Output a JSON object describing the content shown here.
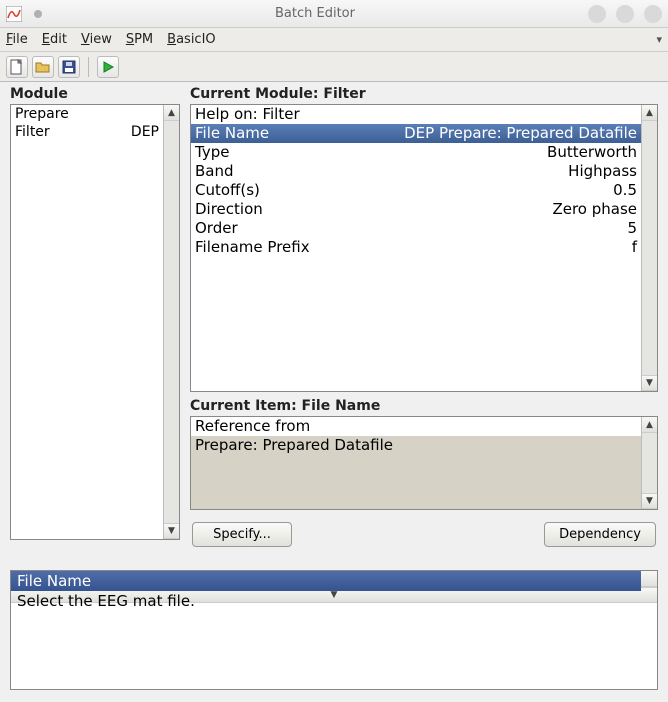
{
  "window": {
    "title": "Batch Editor"
  },
  "menubar": {
    "file": "File",
    "file_u": "F",
    "edit": "Edit",
    "edit_u": "E",
    "view": "View",
    "view_u": "V",
    "spm": "SPM",
    "spm_u": "S",
    "basicio": "BasicIO",
    "basicio_u": "B"
  },
  "toolbar": {
    "new_tip": "New",
    "open_tip": "Open",
    "save_tip": "Save",
    "run_tip": "Run"
  },
  "left": {
    "header": "Module",
    "rows": [
      {
        "label": "Prepare",
        "tag": ""
      },
      {
        "label": "Filter",
        "tag": "DEP"
      }
    ]
  },
  "current_module": {
    "header_prefix": "Current Module: ",
    "header_name": "Filter",
    "rows": [
      {
        "label": "Help on: Filter",
        "value": ""
      },
      {
        "label": "File Name",
        "value": "DEP Prepare: Prepared Datafile",
        "selected": true
      },
      {
        "label": "Type",
        "value": "Butterworth"
      },
      {
        "label": "Band",
        "value": "Highpass"
      },
      {
        "label": "Cutoff(s)",
        "value": "0.5"
      },
      {
        "label": "Direction",
        "value": "Zero phase"
      },
      {
        "label": "Order",
        "value": "5"
      },
      {
        "label": "Filename Prefix",
        "value": "f"
      }
    ]
  },
  "current_item": {
    "header": "Current Item: File Name",
    "rows": [
      {
        "text": "Reference from",
        "white": true
      },
      {
        "text": "Prepare: Prepared Datafile",
        "white": false
      }
    ]
  },
  "buttons": {
    "specify": "Specify...",
    "dependency": "Dependency"
  },
  "help": {
    "title": "File Name",
    "body": "Select the EEG mat file."
  }
}
